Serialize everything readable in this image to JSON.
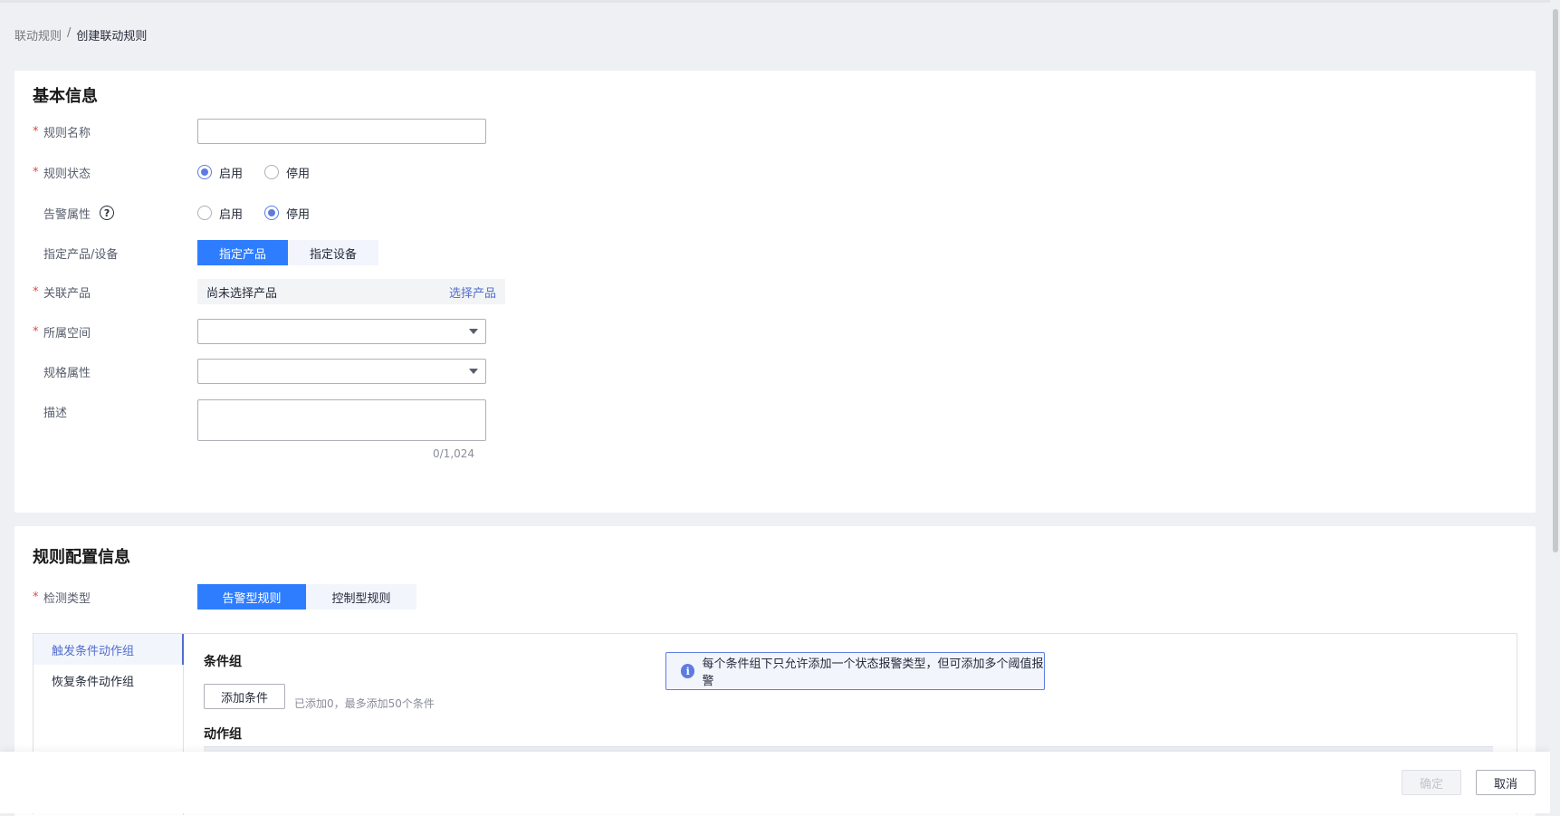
{
  "breadcrumb": {
    "parent": "联动规则",
    "separator": "/",
    "current": "创建联动规则"
  },
  "basic": {
    "title": "基本信息",
    "rule_name": {
      "label": "规则名称",
      "value": "",
      "placeholder": ""
    },
    "rule_status": {
      "label": "规则状态",
      "options": [
        "启用",
        "停用"
      ],
      "selected": "启用"
    },
    "alarm_attr": {
      "label": "告警属性",
      "help": "?",
      "options": [
        "启用",
        "停用"
      ],
      "selected": "停用"
    },
    "target": {
      "label": "指定产品/设备",
      "options": [
        "指定产品",
        "指定设备"
      ],
      "selected": "指定产品"
    },
    "product": {
      "label": "关联产品",
      "value": "尚未选择产品",
      "action": "选择产品"
    },
    "space": {
      "label": "所属空间",
      "value": ""
    },
    "spec": {
      "label": "规格属性",
      "value": ""
    },
    "desc": {
      "label": "描述",
      "value": "",
      "counter": "0/1,024"
    }
  },
  "rule_config": {
    "title": "规则配置信息",
    "detect_type": {
      "label": "检测类型",
      "options": [
        "告警型规则",
        "控制型规则"
      ],
      "selected": "告警型规则"
    },
    "side_tabs": [
      "触发条件动作组",
      "恢复条件动作组"
    ],
    "active_tab": "触发条件动作组",
    "condition_group": {
      "title": "条件组",
      "add_label": "添加条件",
      "hint": "已添加0，最多添加50个条件"
    },
    "notice": {
      "icon": "info-icon",
      "text": "每个条件组下只允许添加一个状态报警类型，但可添加多个阈值报警"
    },
    "action_group": {
      "title": "动作组"
    }
  },
  "footer": {
    "confirm": "确定",
    "cancel": "取消"
  },
  "colors": {
    "primary": "#2e7dff",
    "link": "#526ecc",
    "required": "#e54545"
  }
}
